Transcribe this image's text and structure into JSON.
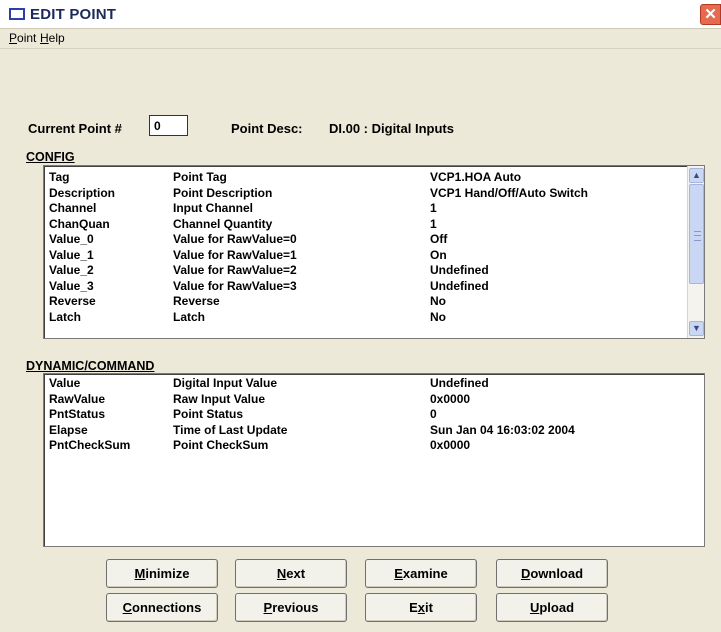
{
  "window": {
    "title": "EDIT POINT",
    "close_glyph": "✕"
  },
  "menu": [
    {
      "hot": "P",
      "rest": "oint"
    },
    {
      "hot": "H",
      "rest": "elp"
    }
  ],
  "current_point": {
    "label": "Current Point #",
    "value": "0"
  },
  "point_desc": {
    "label": "Point Desc:",
    "value": "DI.00 : Digital Inputs"
  },
  "config": {
    "label": "CONFIG",
    "rows": [
      {
        "name": "Tag",
        "desc": "Point Tag",
        "value": "VCP1.HOA Auto"
      },
      {
        "name": "Description",
        "desc": "Point Description",
        "value": "VCP1 Hand/Off/Auto Switch"
      },
      {
        "name": "Channel",
        "desc": "Input Channel",
        "value": "1"
      },
      {
        "name": "ChanQuan",
        "desc": "Channel Quantity",
        "value": "1"
      },
      {
        "name": "Value_0",
        "desc": "Value for RawValue=0",
        "value": "Off"
      },
      {
        "name": "Value_1",
        "desc": "Value for RawValue=1",
        "value": "On"
      },
      {
        "name": "Value_2",
        "desc": "Value for RawValue=2",
        "value": "Undefined"
      },
      {
        "name": "Value_3",
        "desc": "Value for RawValue=3",
        "value": "Undefined"
      },
      {
        "name": "Reverse",
        "desc": "Reverse",
        "value": "No"
      },
      {
        "name": "Latch",
        "desc": "Latch",
        "value": "No"
      }
    ]
  },
  "dynamic": {
    "label": "DYNAMIC/COMMAND",
    "rows": [
      {
        "name": "Value",
        "desc": "Digital Input Value",
        "value": "Undefined"
      },
      {
        "name": "RawValue",
        "desc": "Raw Input Value",
        "value": "0x0000"
      },
      {
        "name": "PntStatus",
        "desc": "Point Status",
        "value": "0"
      },
      {
        "name": "Elapse",
        "desc": "Time of Last Update",
        "value": "Sun Jan 04 16:03:02 2004"
      },
      {
        "name": "PntCheckSum",
        "desc": "Point CheckSum",
        "value": "0x0000"
      }
    ]
  },
  "buttons": {
    "minimize": {
      "hot": "M",
      "rest": "inimize"
    },
    "next": {
      "hot": "N",
      "rest": "ext"
    },
    "examine": {
      "hot": "E",
      "rest": "xamine"
    },
    "download": {
      "hot": "D",
      "rest": "ownload"
    },
    "connections": {
      "hot": "C",
      "rest": "onnections"
    },
    "previous": {
      "hot": "P",
      "rest": "revious"
    },
    "exit_pre": "E",
    "exit_hot": "x",
    "exit_post": "it",
    "upload": {
      "hot": "U",
      "rest": "pload"
    }
  },
  "colors": {
    "background": "#ECE9D8",
    "close": "#E56A4E",
    "title_icon": "#2A3FA8"
  },
  "icons": {
    "scroll_up": "▲",
    "scroll_down": "▼"
  }
}
